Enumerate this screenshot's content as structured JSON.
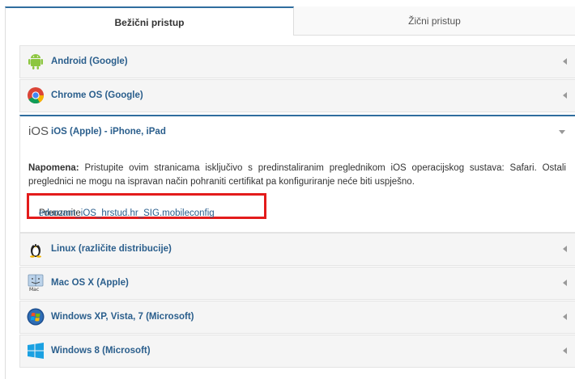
{
  "tabs": [
    {
      "label": "Bežični pristup",
      "active": true
    },
    {
      "label": "Žični pristup",
      "active": false
    }
  ],
  "accordion": {
    "items": [
      {
        "label": "Android (Google)",
        "icon": "android-icon"
      },
      {
        "label": "Chrome OS (Google)",
        "icon": "chrome-icon"
      },
      {
        "label": "iOS (Apple) - iPhone, iPad",
        "icon": "ios-icon",
        "expanded": true
      },
      {
        "label": "Linux (različite distribucije)",
        "icon": "linux-icon"
      },
      {
        "label": "Mac OS X (Apple)",
        "icon": "mac-icon"
      },
      {
        "label": "Windows XP, Vista, 7 (Microsoft)",
        "icon": "windows7-icon"
      },
      {
        "label": "Windows 8 (Microsoft)",
        "icon": "windows8-icon"
      }
    ],
    "ios_panel": {
      "logo_text": "iOS",
      "note_label": "Napomena:",
      "note_text": "Pristupite ovim stranicama isključivo s predinstaliranim preglednikom iOS operacijskog sustava: Safari. Ostali preglednici ne mogu na ispravan način pohraniti certifikat pa konfiguriranje neće biti uspješno.",
      "download_prefix": "Preuzmite ",
      "download_link": "eduroam_iOS_hrstud.hr_SIG.mobileconfig",
      "download_suffix": "."
    }
  },
  "colors": {
    "accent": "#2f6d9e",
    "link": "#2a5e8c",
    "highlight": "#e31b1b"
  }
}
